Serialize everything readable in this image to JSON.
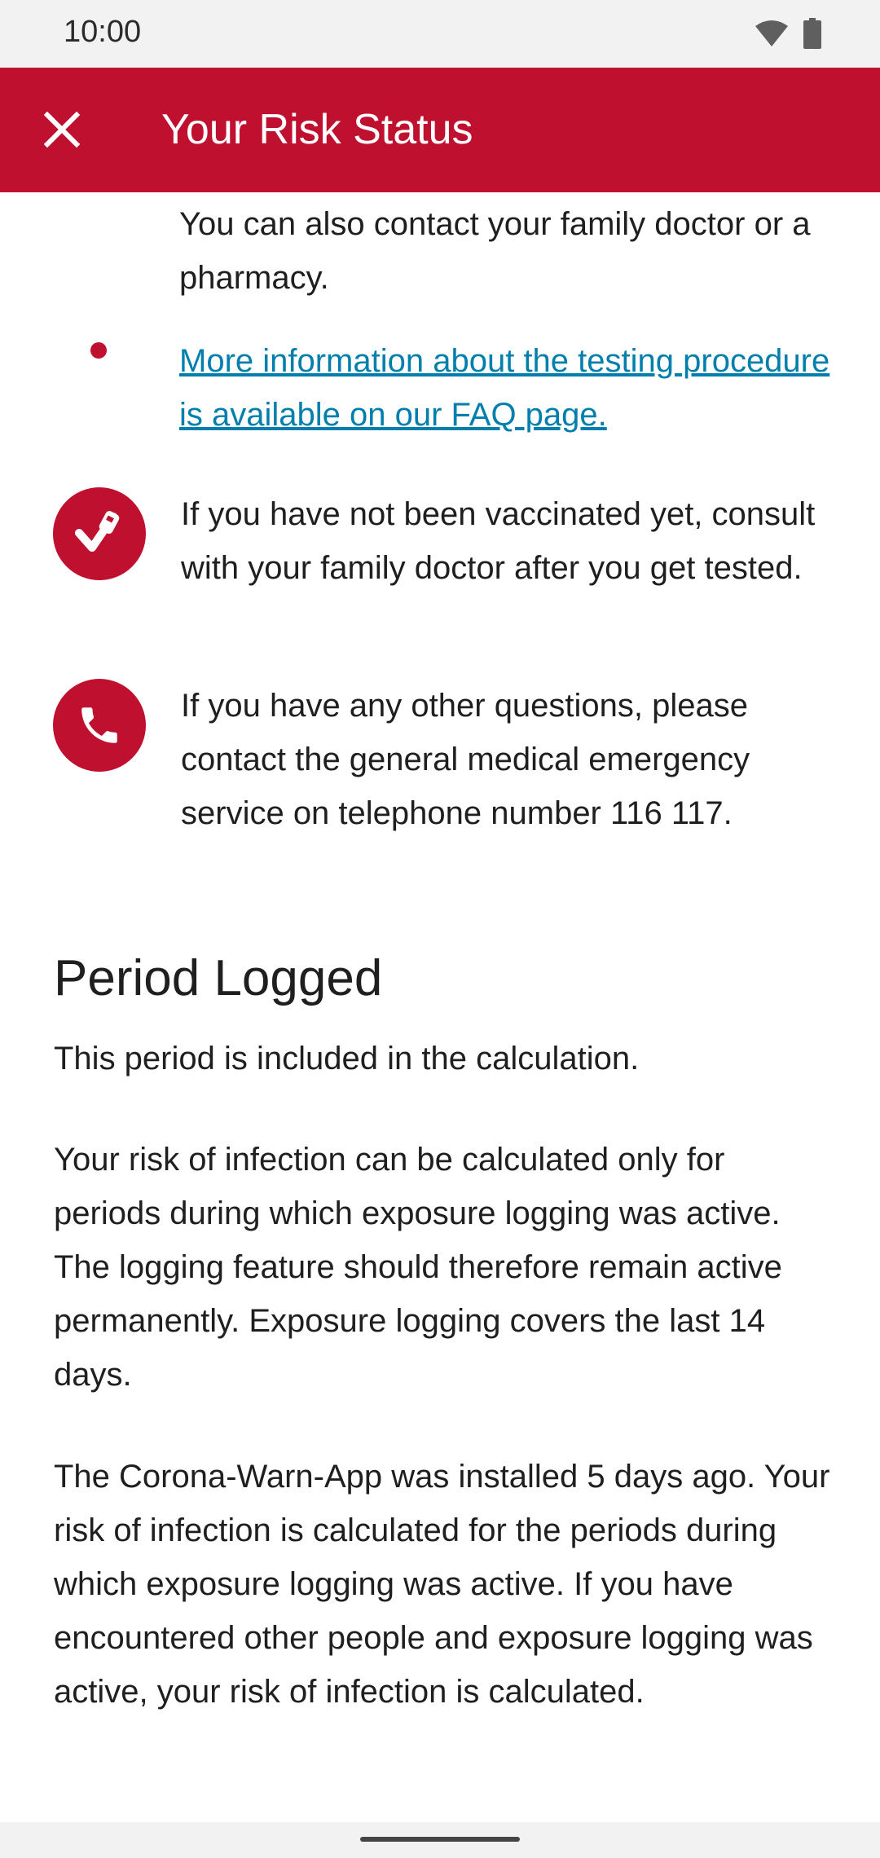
{
  "status_bar": {
    "time": "10:00",
    "icons": [
      "wifi-icon",
      "battery-icon"
    ]
  },
  "app_bar": {
    "title": "Your Risk Status",
    "close_icon": "close-icon",
    "color": "#c0102f"
  },
  "testing": {
    "contact_text": "You can also contact your family doctor or a pharmacy.",
    "faq_link": "More information about the testing procedure is available on our FAQ page.",
    "link_color": "#007fad"
  },
  "advice": [
    {
      "icon": "vaccination-icon",
      "text": "If you have not been vaccinated yet, consult with your family doctor after you get tested."
    },
    {
      "icon": "phone-icon",
      "text": "If you have any other questions, please contact the general medical emergency service on telephone number 116 117."
    }
  ],
  "period": {
    "title": "Period Logged",
    "subtitle": "This period is included in the calculation.",
    "paragraph1": "Your risk of infection can be calculated only for periods during which exposure logging was active. The logging feature should therefore remain active permanently. Exposure logging covers the last 14 days.",
    "paragraph2": "The Corona-Warn-App was installed 5 days ago. Your risk of infection is calculated for the periods during which exposure logging was active. If you have encountered other people and exposure logging was active, your risk of infection is calculated."
  }
}
